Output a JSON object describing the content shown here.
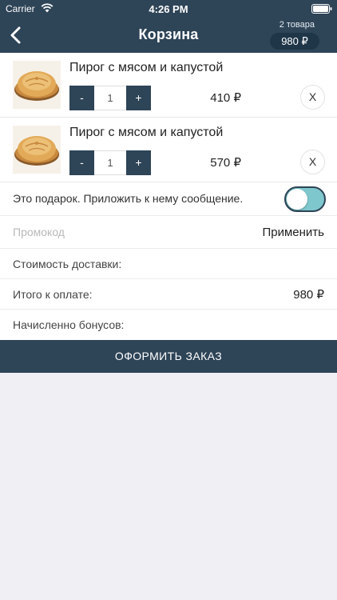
{
  "status_bar": {
    "carrier": "Carrier",
    "time": "4:26 PM"
  },
  "header": {
    "title": "Корзина",
    "item_count": "2 товара",
    "total": "980 ₽",
    "back_icon": "chevron-left-icon"
  },
  "cart": {
    "items": [
      {
        "name": "Пирог с мясом и капустой",
        "minus": "-",
        "quantity": "1",
        "plus": "+",
        "price": "410 ₽",
        "remove": "X"
      },
      {
        "name": "Пирог с мясом и капустой",
        "minus": "-",
        "quantity": "1",
        "plus": "+",
        "price": "570 ₽",
        "remove": "X"
      }
    ]
  },
  "gift": {
    "label": "Это подарок. Приложить к нему сообщение.",
    "enabled": false
  },
  "promo": {
    "placeholder": "Промокод",
    "value": "",
    "apply_label": "Применить"
  },
  "summary": {
    "delivery_label": "Стоимость доставки:",
    "delivery_value": "",
    "total_label": "Итого к оплате:",
    "total_value": "980 ₽",
    "bonus_label": "Начисленно бонусов:",
    "bonus_value": ""
  },
  "checkout": {
    "label": "ОФОРМИТЬ ЗАКАЗ"
  },
  "colors": {
    "header_bg": "#2e4457",
    "badge_bg": "#1f3649",
    "toggle_fill": "#7ec7cd",
    "background": "#efeff4"
  }
}
